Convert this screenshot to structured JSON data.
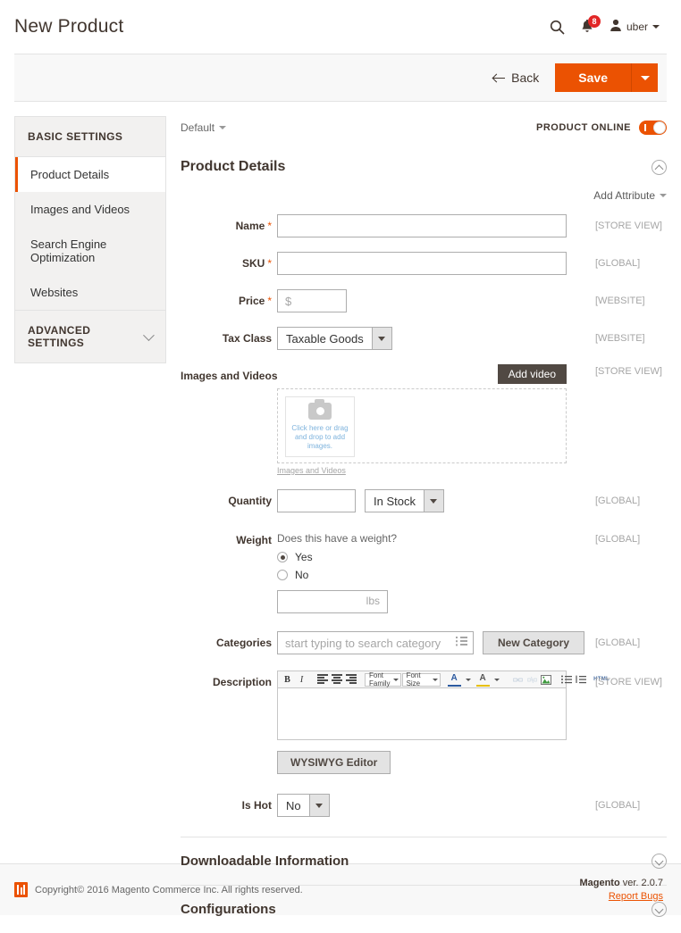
{
  "header": {
    "title": "New Product",
    "search_icon": "search-icon",
    "notifications_icon": "bell-icon",
    "notifications_count": "8",
    "user_icon": "user-icon",
    "user_name": "uber"
  },
  "actions": {
    "back_label": "Back",
    "save_label": "Save",
    "save_caret_icon": "chevron-down-icon"
  },
  "sidebar": {
    "basic_settings_label": "BASIC SETTINGS",
    "items": [
      {
        "label": "Product Details",
        "active": true
      },
      {
        "label": "Images and Videos",
        "active": false
      },
      {
        "label": "Search Engine Optimization",
        "active": false
      },
      {
        "label": "Websites",
        "active": false
      }
    ],
    "advanced_settings_label": "ADVANCED SETTINGS",
    "advanced_chevron_icon": "chevron-down-icon"
  },
  "content": {
    "store_switcher": "Default",
    "product_online_label": "PRODUCT ONLINE",
    "product_online_state": "on",
    "section_title": "Product Details",
    "add_attribute_label": "Add Attribute",
    "fields": {
      "name": {
        "label": "Name",
        "required": true,
        "value": "",
        "placeholder": "",
        "scope": "[STORE VIEW]"
      },
      "sku": {
        "label": "SKU",
        "required": true,
        "value": "",
        "placeholder": "",
        "scope": "[GLOBAL]"
      },
      "price": {
        "label": "Price",
        "required": true,
        "value": "",
        "placeholder": "$",
        "scope": "[WEBSITE]"
      },
      "tax_class": {
        "label": "Tax Class",
        "value": "Taxable Goods",
        "scope": "[WEBSITE]"
      },
      "images": {
        "label": "Images and Videos",
        "add_video_label": "Add video",
        "placeholder_text": "Click here or drag and drop to add images.",
        "link_label": "Images and Videos",
        "scope": "[STORE VIEW]"
      },
      "quantity": {
        "label": "Quantity",
        "value": "",
        "stock_status": "In Stock",
        "scope": "[GLOBAL]"
      },
      "weight": {
        "label": "Weight",
        "question": "Does this have a weight?",
        "option_yes": "Yes",
        "option_no": "No",
        "selected": "Yes",
        "value": "",
        "unit": "lbs",
        "scope": "[GLOBAL]"
      },
      "categories": {
        "label": "Categories",
        "placeholder": "start typing to search category",
        "value": "",
        "new_category_label": "New Category",
        "scope": "[GLOBAL]"
      },
      "description": {
        "label": "Description",
        "value": "",
        "wysiwyg_label": "WYSIWYG Editor",
        "scope": "[STORE VIEW]",
        "toolbar": {
          "bold": "B",
          "italic": "I",
          "font_family": "Font Family",
          "font_size": "Font Size",
          "text_color": "A",
          "highlight": "A",
          "html": "HTML"
        }
      },
      "is_hot": {
        "label": "Is Hot",
        "value": "No",
        "scope": "[GLOBAL]"
      }
    },
    "collapsed_sections": [
      {
        "title": "Downloadable Information",
        "icon": "chevron-down-circle-icon"
      },
      {
        "title": "Configurations",
        "icon": "chevron-down-circle-icon"
      }
    ]
  },
  "footer": {
    "copyright": "Copyright© 2016 Magento Commerce Inc. All rights reserved.",
    "brand": "Magento",
    "version": " ver. 2.0.7",
    "report_bugs": "Report Bugs"
  },
  "colors": {
    "accent": "#eb5202",
    "dark": "#514943",
    "badge": "#e22626",
    "link_blue": "#7eb3dd"
  }
}
